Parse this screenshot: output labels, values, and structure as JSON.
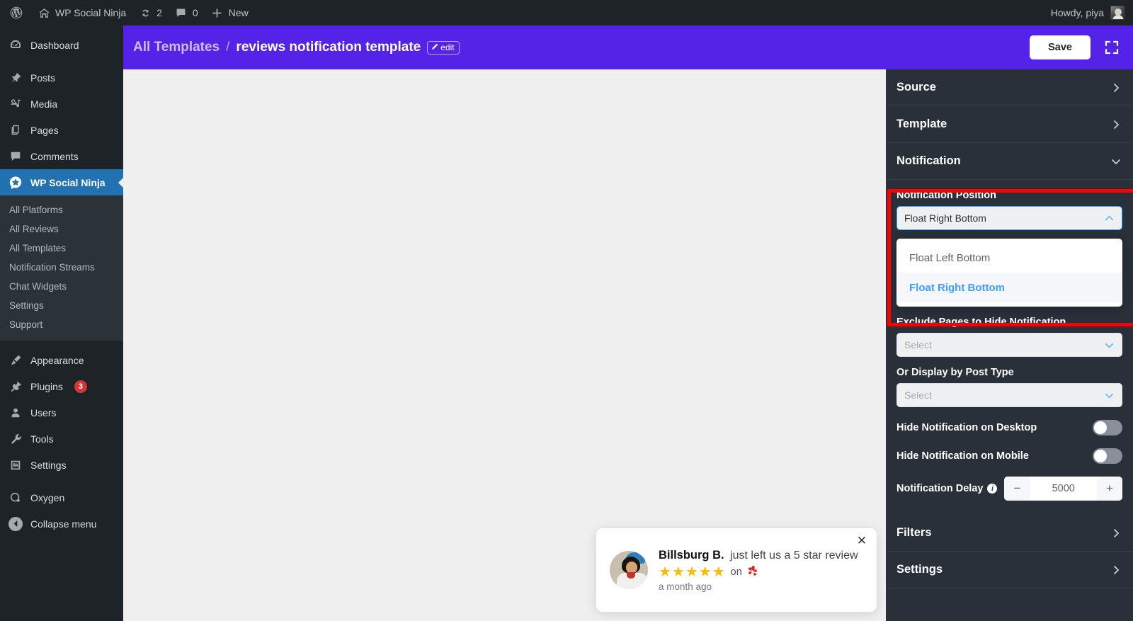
{
  "adminbar": {
    "logo_icon": "wordpress-icon",
    "site_icon": "home-icon",
    "site_name": "WP Social Ninja",
    "updates_icon": "updates-icon",
    "updates_count": "2",
    "comments_icon": "comment-icon",
    "comments_count": "0",
    "new_icon": "plus-icon",
    "new_label": "New",
    "howdy": "Howdy, piya"
  },
  "sidebar": {
    "items": [
      {
        "label": "Dashboard",
        "icon": "dashboard-icon"
      },
      {
        "label": "Posts",
        "icon": "pin-icon"
      },
      {
        "label": "Media",
        "icon": "media-icon"
      },
      {
        "label": "Pages",
        "icon": "pages-icon"
      },
      {
        "label": "Comments",
        "icon": "comment-icon"
      },
      {
        "label": "WP Social Ninja",
        "icon": "social-ninja-star-icon"
      }
    ],
    "submenu": [
      {
        "label": "All Platforms"
      },
      {
        "label": "All Reviews"
      },
      {
        "label": "All Templates"
      },
      {
        "label": "Notification Streams"
      },
      {
        "label": "Chat Widgets"
      },
      {
        "label": "Settings"
      },
      {
        "label": "Support"
      }
    ],
    "items2": [
      {
        "label": "Appearance",
        "icon": "brush-icon",
        "badge": ""
      },
      {
        "label": "Plugins",
        "icon": "plug-icon",
        "badge": "3"
      },
      {
        "label": "Users",
        "icon": "user-icon",
        "badge": ""
      },
      {
        "label": "Tools",
        "icon": "wrench-icon",
        "badge": ""
      },
      {
        "label": "Settings",
        "icon": "settings-icon",
        "badge": ""
      }
    ],
    "items3": [
      {
        "label": "Oxygen",
        "icon": "oxygen-icon"
      }
    ],
    "collapse_label": "Collapse menu"
  },
  "topbar": {
    "breadcrumb_root": "All Templates",
    "breadcrumb_sep": "/",
    "breadcrumb_current": "reviews notification template",
    "edit_label": "edit",
    "edit_icon": "pencil-icon",
    "save_label": "Save",
    "expand_icon": "fullscreen-icon",
    "accent_color": "#5522e8"
  },
  "notification_card": {
    "name": "Billsburg B.",
    "action": "just left us a 5 star review",
    "stars": "★★★★★",
    "star_count": 5,
    "star_color": "#fbbc04",
    "on_word": "on",
    "platform_icon": "yelp-icon",
    "time": "a month ago",
    "close_icon": "close-icon",
    "avatar_icon": "avatar"
  },
  "panel": {
    "sections_top": [
      {
        "label": "Source",
        "icon": "chevron-right-icon",
        "state": "collapsed"
      },
      {
        "label": "Template",
        "icon": "chevron-right-icon",
        "state": "collapsed"
      },
      {
        "label": "Notification",
        "icon": "chevron-down-icon",
        "state": "expanded"
      }
    ],
    "notification_position": {
      "label": "Notification Position",
      "value": "Float Right Bottom",
      "toggle_icon": "chevron-up-icon",
      "options": [
        {
          "label": "Float Left Bottom",
          "selected": false
        },
        {
          "label": "Float Right Bottom",
          "selected": true
        }
      ]
    },
    "exclude_pages": {
      "label": "Exclude Pages to Hide Notification",
      "placeholder": "Select",
      "toggle_icon": "chevron-down-icon"
    },
    "post_type": {
      "label": "Or Display by Post Type",
      "placeholder": "Select",
      "toggle_icon": "chevron-down-icon"
    },
    "hide_desktop": {
      "label": "Hide Notification on Desktop",
      "state": "off"
    },
    "hide_mobile": {
      "label": "Hide Notification on Mobile",
      "state": "off"
    },
    "delay": {
      "label": "Notification Delay",
      "info_icon": "info-icon",
      "minus": "−",
      "value": "5000",
      "plus": "+"
    },
    "sections_bottom": [
      {
        "label": "Filters",
        "icon": "chevron-right-icon"
      },
      {
        "label": "Settings",
        "icon": "chevron-right-icon"
      }
    ],
    "highlight_color": "#ff0000"
  }
}
